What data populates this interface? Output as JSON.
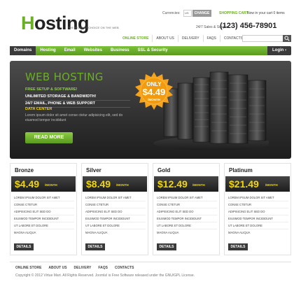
{
  "header": {
    "logo_first": "H",
    "logo_rest": "osting",
    "tagline": "THE BIGGEST CHOICE ON THE WEB",
    "currencies_label": "Currencies:",
    "currency_value": "US Dollar",
    "change_label": "CHANGE",
    "cart_title": "SHOPPING CART",
    "cart_count": "Now in your cart 0 items",
    "support_label": "24/7 Sales & Support",
    "phone": "(123) 456-78901"
  },
  "top_nav": [
    "ONLINE STORE",
    "ABOUT US",
    "DELIVERY",
    "FAQS",
    "CONTACTS"
  ],
  "main_nav": {
    "items": [
      "Domains",
      "Hosting",
      "Email",
      "Websites",
      "Business",
      "SSL & Security"
    ],
    "login": "Login ›"
  },
  "hero": {
    "title": "WEB HOSTING",
    "sub": "FREE SETUP & SOFTWARE!",
    "features": [
      "UNLIMITED STORAGE & BANDWIDTH!",
      "24/7 EMAIL, PHONE & WEB SUPPORT"
    ],
    "datacenter": "DATA CENTER",
    "desc": "Lorem ipsum dolor sit amet conse ctetur adipisicing elit, sed do eiusmod tempor incididunt",
    "button": "READ MORE",
    "burst_only": "ONLY",
    "burst_price": "$4.49",
    "burst_unit": "/MONTH"
  },
  "plans": [
    {
      "name": "Bronze",
      "price": "$4.49",
      "unit": "/MONTH"
    },
    {
      "name": "Silver",
      "price": "$8.49",
      "unit": "/MONTH"
    },
    {
      "name": "Gold",
      "price": "$12.49",
      "unit": "/MONTH"
    },
    {
      "name": "Platinum",
      "price": "$21.49",
      "unit": "/MONTH"
    }
  ],
  "plan_features": [
    "LOREM IPSUM DOLOR SIT AMET",
    "CONSE CTETUR",
    "ADIPISICING ELIT SED DO",
    "EIUSMOD TEMPOR INCIDIDUNT",
    "UT LABORE ET DOLORE",
    "MAGNA ALIQUA"
  ],
  "plan_button": "DETAILS",
  "footer": {
    "nav": [
      "ONLINE STORE",
      "ABOUT US",
      "DELIVERY",
      "FAQS",
      "CONTACTS"
    ],
    "copyright": "Copyright © 2012 Virtue Mart.  All Rights Reserved. Joomla! is Free Software released under the GNU/GPL License."
  },
  "colors": {
    "brand_green": "#6ab023",
    "price_yellow": "#f3d600",
    "burst_orange": "#f7a21b",
    "dark": "#1d1d1d"
  },
  "icons": {
    "search": "search-icon",
    "servers": "server-rack-image"
  }
}
